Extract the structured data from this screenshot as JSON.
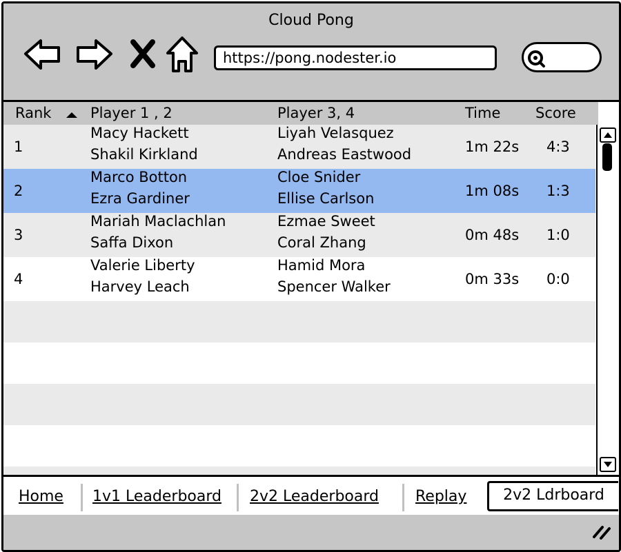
{
  "window": {
    "title": "Cloud Pong"
  },
  "browser": {
    "url": "https://pong.nodester.io",
    "icons": [
      "back-arrow-icon",
      "forward-arrow-icon",
      "close-x-icon",
      "home-icon",
      "search-icon"
    ]
  },
  "table": {
    "headers": {
      "rank": "Rank",
      "players_a": "Player 1 , 2",
      "players_b": "Player 3, 4",
      "time": "Time",
      "score": "Score"
    },
    "sort": {
      "column": "Rank",
      "direction": "ascending"
    },
    "selected_rank": "2",
    "rows": [
      {
        "rank": "1",
        "p1": "Macy Hackett",
        "p2": "Shakil Kirkland",
        "p3": "Liyah Velasquez",
        "p4": "Andreas Eastwood",
        "time": "1m 22s",
        "score": "4:3"
      },
      {
        "rank": "2",
        "p1": "Marco Botton",
        "p2": "Ezra Gardiner",
        "p3": "Cloe Snider",
        "p4": "Ellise Carlson",
        "time": "1m 08s",
        "score": "1:3"
      },
      {
        "rank": "3",
        "p1": "Mariah Maclachlan",
        "p2": "Saffa Dixon",
        "p3": "Ezmae Sweet",
        "p4": "Coral Zhang",
        "time": "0m 48s",
        "score": "1:0"
      },
      {
        "rank": "4",
        "p1": "Valerie Liberty",
        "p2": "Harvey Leach",
        "p3": "Hamid Mora",
        "p4": "Spencer Walker",
        "time": "0m 33s",
        "score": "0:0"
      }
    ]
  },
  "tabs": {
    "home": "Home",
    "lb_1v1": "1v1 Leaderboard",
    "lb_2v2": "2v2 Leaderboard",
    "replay": "Replay",
    "active": "2v2 Ldrboard"
  },
  "colors": {
    "chrome_gray": "#c6c6c6",
    "row_alt": "#eaeaea",
    "selection": "#94b9f0"
  }
}
